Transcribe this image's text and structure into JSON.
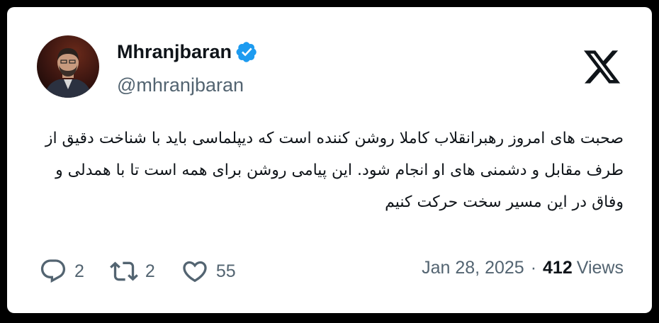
{
  "author": {
    "name": "Mhranjbaran",
    "handle": "@mhranjbaran"
  },
  "tweet": {
    "text": "صحبت های امروز رهبرانقلاب کاملا روشن کننده است که دیپلماسی باید با شناخت دقیق از طرف مقابل و دشمنی های او انجام شود. این پیامی روشن برای همه است تا با همدلی و وفاق در این مسیر سخت حرکت کنیم"
  },
  "stats": {
    "replies": "2",
    "reposts": "2",
    "likes": "55"
  },
  "meta": {
    "date": "Jan 28, 2025",
    "separator": "·",
    "views_count": "412",
    "views_label": "Views"
  },
  "icons": {
    "verified": "verified-badge-icon",
    "brand": "x-logo-icon",
    "reply": "reply-icon",
    "repost": "repost-icon",
    "like": "heart-icon"
  },
  "colors": {
    "background": "#000000",
    "card": "#ffffff",
    "text_primary": "#0f1419",
    "text_secondary": "#536471",
    "verified": "#1d9bf0"
  }
}
